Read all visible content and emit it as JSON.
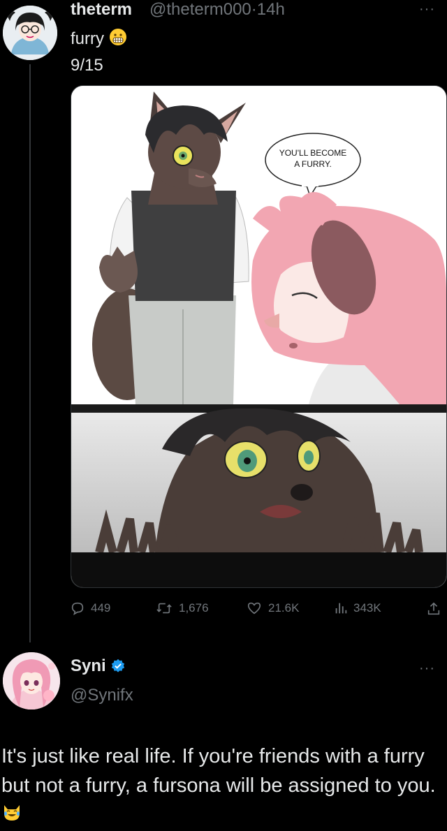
{
  "tweet": {
    "display_name": "theterm",
    "handle": "@theterm000",
    "separator": "·",
    "time": "14h",
    "text_line1": "furry",
    "text_line2": "9/15",
    "speech_bubble_line1": "YOU'LL BECOME",
    "speech_bubble_line2": "A FURRY.",
    "stats": {
      "replies": "449",
      "retweets": "1,676",
      "likes": "21.6K",
      "views": "343K"
    }
  },
  "reply": {
    "display_name": "Syni",
    "handle": "@Synifx",
    "text": "It's just like real life. If you're friends with a furry but not a furry, a fursona will be assigned to you."
  },
  "icons": {
    "more": "more-icon",
    "verified": "verified-badge-icon",
    "grimace_emoji": "grimacing-face-emoji",
    "laugh_cat_emoji": "cat-tears-of-joy-emoji",
    "reply": "reply-icon",
    "retweet": "retweet-icon",
    "like": "heart-icon",
    "views": "views-icon",
    "share": "share-icon"
  },
  "colors": {
    "background": "#000000",
    "text": "#e7e9ea",
    "muted": "#71767b",
    "verified": "#1d9bf0"
  }
}
